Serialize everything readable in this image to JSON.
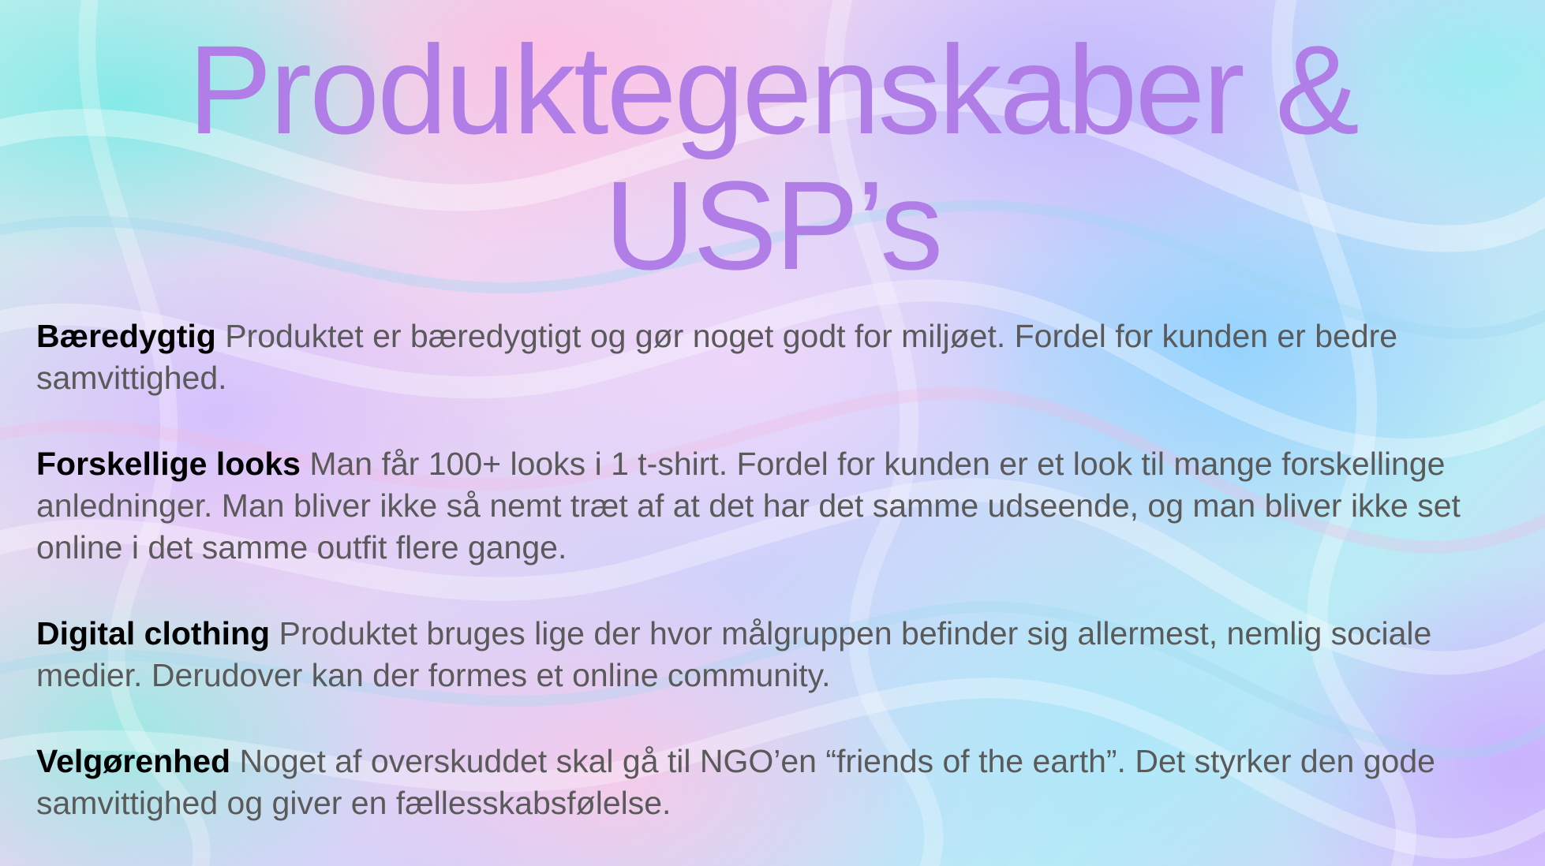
{
  "slide": {
    "title_line1": "Produktegenskaber &",
    "title_line2": "USP’s",
    "colors": {
      "title": "#b07ee6",
      "heading": "#000000",
      "body": "#5a5a5a"
    },
    "items": [
      {
        "heading": "Bæredygtig",
        "text": " Produktet er bæredygtigt og gør noget godt for miljøet. Fordel for kunden er bedre samvittighed."
      },
      {
        "heading": "Forskellige looks",
        "text": " Man får 100+ looks i 1 t-shirt. Fordel for kunden er et look til mange forskellinge anledninger. Man bliver ikke så nemt træt af at det har det samme udseende, og man bliver ikke set online i det samme outfit flere gange."
      },
      {
        "heading": "Digital clothing",
        "text": " Produktet bruges lige der hvor målgruppen befinder sig allermest, nemlig sociale medier. Derudover kan der formes et online community."
      },
      {
        "heading": "Velgørenhed",
        "text": " Noget af overskuddet skal gå til NGO’en “friends of the earth”. Det styrker den gode samvittighed og giver en fællesskabsfølelse."
      }
    ]
  }
}
